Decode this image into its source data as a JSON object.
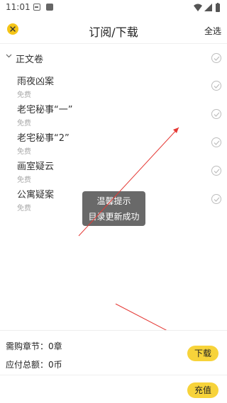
{
  "status_bar": {
    "time": "11:01"
  },
  "header": {
    "title": "订阅/下载",
    "select_all": "全选"
  },
  "volume": {
    "title": "正文卷"
  },
  "chapters": [
    {
      "title": "雨夜凶案",
      "price": "免费"
    },
    {
      "title": "老宅秘事“一”",
      "price": "免费"
    },
    {
      "title": "老宅秘事“2”",
      "price": "免费"
    },
    {
      "title": "画室疑云",
      "price": "免费"
    },
    {
      "title": "公寓疑案",
      "price": "免费"
    }
  ],
  "toast": {
    "title": "温馨提示",
    "message": "目录更新成功"
  },
  "summary": {
    "need_label": "需购章节：",
    "need_value": "0章",
    "pay_label": "应付总额：",
    "pay_value": "0币"
  },
  "buttons": {
    "download": "下载",
    "recharge": "充值"
  },
  "colors": {
    "accent": "#f7d33a",
    "annotation": "#e53935"
  }
}
